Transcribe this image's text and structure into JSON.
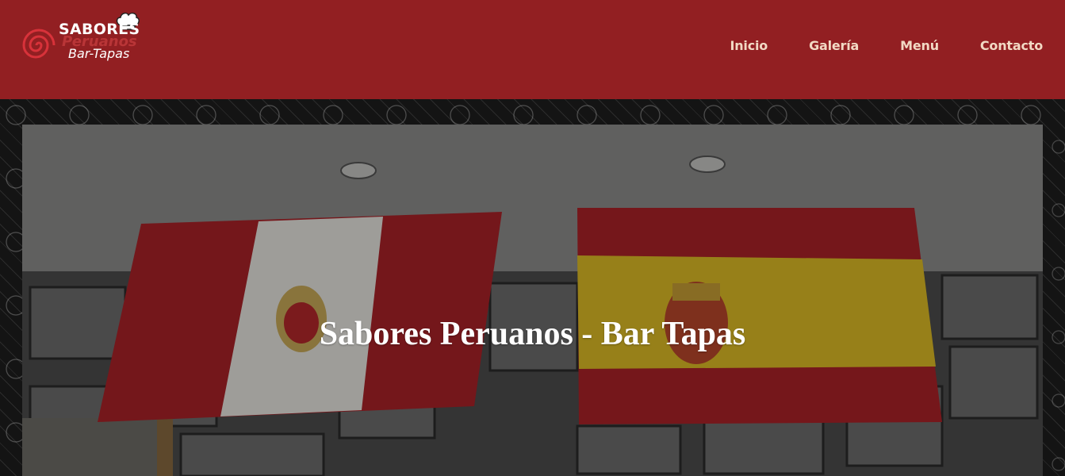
{
  "brand": {
    "line1": "SABORES",
    "line1_accent": "Peruanos",
    "line2": "Bar-Tapas"
  },
  "nav": {
    "items": [
      "Inicio",
      "Galería",
      "Menú",
      "Contacto"
    ]
  },
  "hero": {
    "title": "Sabores Peruanos - Bar Tapas"
  },
  "colors": {
    "header_bg": "#921f22",
    "nav_text": "#f2d9c4",
    "peru_red": "#b3242a",
    "spain_red": "#b3242a",
    "spain_yellow": "#e3c12a"
  }
}
